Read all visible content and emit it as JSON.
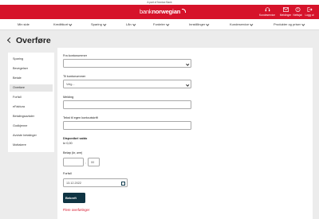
{
  "brand": {
    "top_note": "A part of Nordax Bank",
    "logo_regular": "bank",
    "logo_bold": "norwegian",
    "color": "#d6132a"
  },
  "header_icons": [
    {
      "name": "headset-icon",
      "label": "Kundeservice"
    },
    {
      "name": "mail-icon",
      "label": "Meldinger"
    },
    {
      "name": "help-icon",
      "label": "Nettsjat"
    },
    {
      "name": "logout-icon",
      "label": "Logg ut"
    }
  ],
  "nav": [
    {
      "label": "Min side",
      "chevron": false
    },
    {
      "label": "Kredittkort",
      "chevron": true
    },
    {
      "label": "Sparing",
      "chevron": true
    },
    {
      "label": "Lån",
      "chevron": true
    },
    {
      "label": "Fordeler",
      "chevron": true
    },
    {
      "label": "Innstillinger",
      "chevron": true
    },
    {
      "label": "Kundeservice",
      "chevron": true
    },
    {
      "label": "Produkter og priser",
      "chevron": true
    }
  ],
  "page": {
    "title": "Overføre"
  },
  "sidebar": {
    "items": [
      "Sparing",
      "Bevegelser",
      "Betale",
      "Overføre",
      "Forfall",
      "eFaktura",
      "Betalingsavtaler",
      "Godkjenne",
      "Avviste betalinger",
      "Mottakere"
    ],
    "active_index": 3
  },
  "form": {
    "from_label": "Fra kontonummer",
    "from_value": "",
    "to_label": "Til kontonummer",
    "to_value": "Velg...",
    "message_label": "Melding",
    "message_value": "",
    "text_label": "Tekst til egen kontoutskrift",
    "text_value": "",
    "available_label": "Disponibel saldo",
    "available_value": "kr 0,00",
    "amount_label": "Beløp (kr, øre)",
    "amount_kr": "",
    "amount_separator": ",",
    "amount_ore": "00",
    "due_label": "Forfall",
    "due_value": "13.12.2022",
    "submit_label": "Bekreft",
    "multiple_link": "Flere overføringer"
  }
}
